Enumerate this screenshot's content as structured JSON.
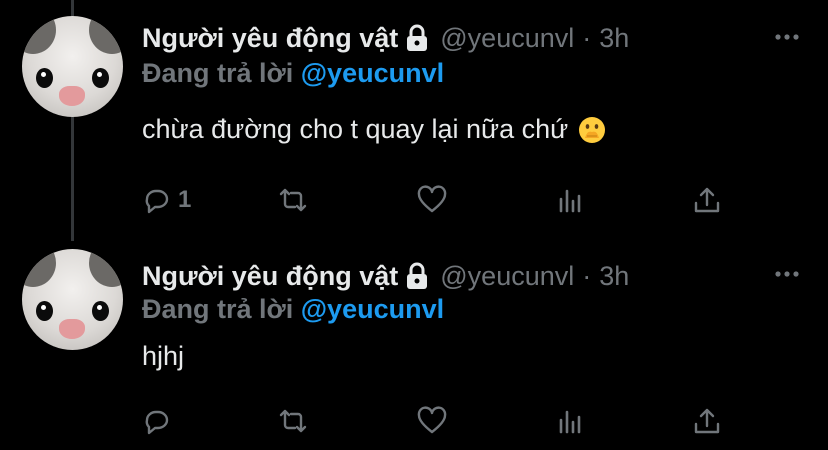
{
  "tweets": [
    {
      "author_name": "Người yêu động vật",
      "handle": "@yeucunvl",
      "separator": "·",
      "time": "3h",
      "reply_prefix": "Đang trả lời",
      "reply_to": "@yeucunvl",
      "text": "chừa đường cho t quay lại nữa chứ",
      "emoji": "face-with-hand-over-mouth",
      "reply_count": "1"
    },
    {
      "author_name": "Người yêu động vật",
      "handle": "@yeucunvl",
      "separator": "·",
      "time": "3h",
      "reply_prefix": "Đang trả lời",
      "reply_to": "@yeucunvl",
      "text": "hjhj",
      "reply_count": ""
    }
  ],
  "icons": {
    "protected": "lock-icon",
    "more": "more-icon",
    "reply": "reply-icon",
    "retweet": "retweet-icon",
    "like": "heart-icon",
    "views": "views-icon",
    "share": "share-icon"
  },
  "colors": {
    "background": "#000000",
    "text": "#e7e9ea",
    "muted": "#71767b",
    "mention": "#1d9bf0",
    "thread_line": "#333639"
  }
}
